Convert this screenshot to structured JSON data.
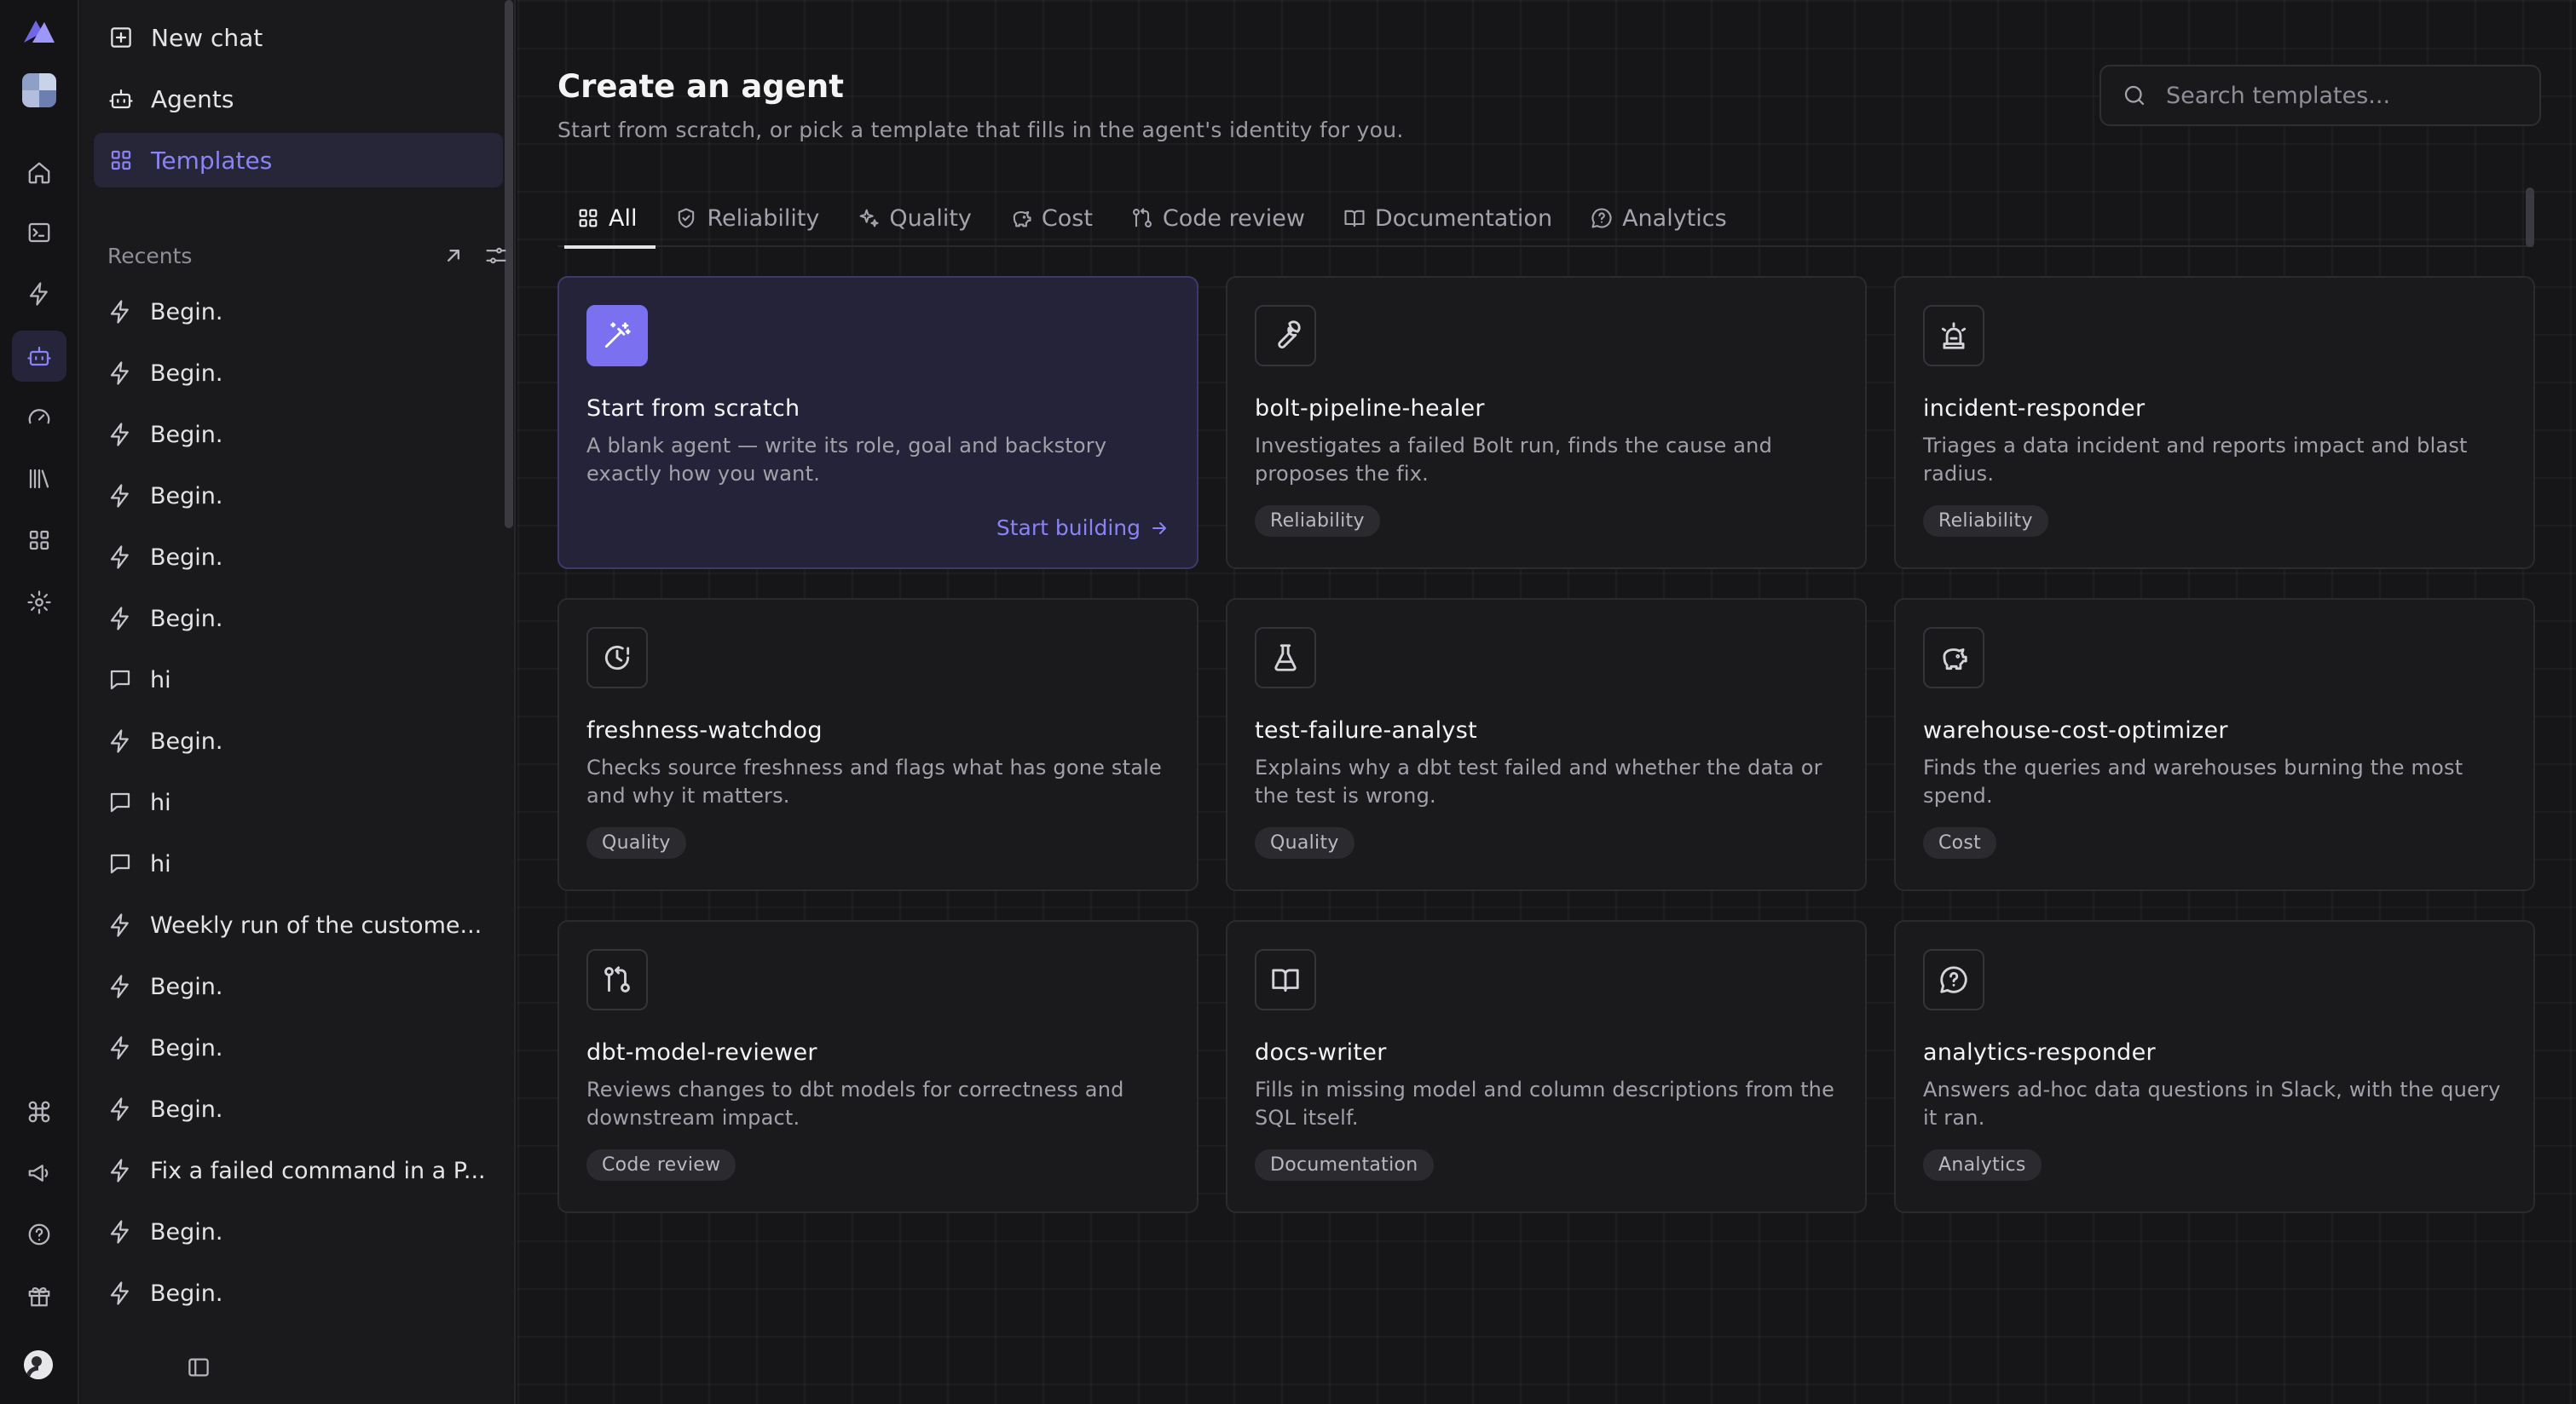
{
  "sidebar": {
    "nav": [
      {
        "label": "New chat",
        "icon": "square-plus-icon"
      },
      {
        "label": "Agents",
        "icon": "bot-icon"
      },
      {
        "label": "Templates",
        "icon": "grid-icon"
      }
    ],
    "recents_label": "Recents",
    "recents": [
      {
        "label": "Begin.",
        "icon": "bolt-icon"
      },
      {
        "label": "Begin.",
        "icon": "bolt-icon"
      },
      {
        "label": "Begin.",
        "icon": "bolt-icon"
      },
      {
        "label": "Begin.",
        "icon": "bolt-icon"
      },
      {
        "label": "Begin.",
        "icon": "bolt-icon"
      },
      {
        "label": "Begin.",
        "icon": "bolt-icon"
      },
      {
        "label": "hi",
        "icon": "chat-icon"
      },
      {
        "label": "Begin.",
        "icon": "bolt-icon"
      },
      {
        "label": "hi",
        "icon": "chat-icon"
      },
      {
        "label": "hi",
        "icon": "chat-icon"
      },
      {
        "label": "Weekly run of the custome...",
        "icon": "bolt-icon"
      },
      {
        "label": "Begin.",
        "icon": "bolt-icon"
      },
      {
        "label": "Begin.",
        "icon": "bolt-icon"
      },
      {
        "label": "Begin.",
        "icon": "bolt-icon"
      },
      {
        "label": "Fix a failed command in a P...",
        "icon": "bolt-icon"
      },
      {
        "label": "Begin.",
        "icon": "bolt-icon"
      },
      {
        "label": "Begin.",
        "icon": "bolt-icon"
      }
    ]
  },
  "main": {
    "title": "Create an agent",
    "subtitle": "Start from scratch, or pick a template that fills in the agent's identity for you.",
    "search_placeholder": "Search templates...",
    "tabs": [
      {
        "label": "All",
        "icon": "grid-icon"
      },
      {
        "label": "Reliability",
        "icon": "shield-check-icon"
      },
      {
        "label": "Quality",
        "icon": "sparkles-icon"
      },
      {
        "label": "Cost",
        "icon": "piggy-bank-icon"
      },
      {
        "label": "Code review",
        "icon": "git-compare-icon"
      },
      {
        "label": "Documentation",
        "icon": "book-icon"
      },
      {
        "label": "Analytics",
        "icon": "message-question-icon"
      }
    ],
    "scratch": {
      "title": "Start from scratch",
      "description": "A blank agent — write its role, goal and backstory exactly how you want.",
      "cta": "Start building"
    },
    "templates": [
      {
        "name": "bolt-pipeline-healer",
        "description": "Investigates a failed Bolt run, finds the cause and proposes the fix.",
        "tag": "Reliability",
        "icon": "wrench-icon"
      },
      {
        "name": "incident-responder",
        "description": "Triages a data incident and reports impact and blast radius.",
        "tag": "Reliability",
        "icon": "siren-icon"
      },
      {
        "name": "freshness-watchdog",
        "description": "Checks source freshness and flags what has gone stale and why it matters.",
        "tag": "Quality",
        "icon": "clock-alert-icon"
      },
      {
        "name": "test-failure-analyst",
        "description": "Explains why a dbt test failed and whether the data or the test is wrong.",
        "tag": "Quality",
        "icon": "flask-icon"
      },
      {
        "name": "warehouse-cost-optimizer",
        "description": "Finds the queries and warehouses burning the most spend.",
        "tag": "Cost",
        "icon": "piggy-bank-icon"
      },
      {
        "name": "dbt-model-reviewer",
        "description": "Reviews changes to dbt models for correctness and downstream impact.",
        "tag": "Code review",
        "icon": "git-compare-icon"
      },
      {
        "name": "docs-writer",
        "description": "Fills in missing model and column descriptions from the SQL itself.",
        "tag": "Documentation",
        "icon": "book-icon"
      },
      {
        "name": "analytics-responder",
        "description": "Answers ad-hoc data questions in Slack, with the query it ran.",
        "tag": "Analytics",
        "icon": "message-question-icon"
      }
    ]
  },
  "colors": {
    "accent": "#8b83f5",
    "accent_fill": "#7b70f0",
    "background": "#161618",
    "sidebar": "#1a1a1d"
  }
}
